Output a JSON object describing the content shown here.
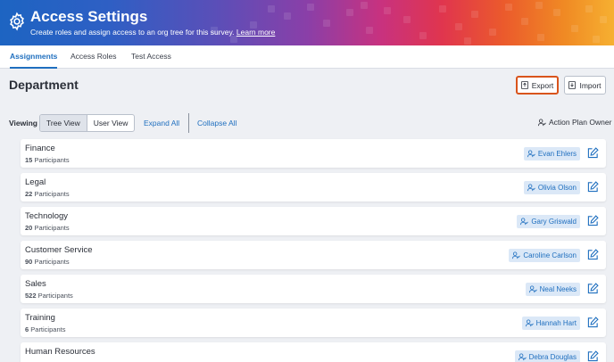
{
  "banner": {
    "title": "Access Settings",
    "subtitle": "Create roles and assign access to an org tree for this survey.",
    "learn_more": "Learn more",
    "icon": "gear-icon"
  },
  "tabs": [
    {
      "label": "Assignments",
      "active": true
    },
    {
      "label": "Access Roles",
      "active": false
    },
    {
      "label": "Test Access",
      "active": false
    }
  ],
  "page_title": "Department",
  "toolbar": {
    "export_label": "Export",
    "import_label": "Import"
  },
  "view": {
    "viewing_label": "Viewing",
    "tree_view": "Tree View",
    "user_view": "User View",
    "expand_all": "Expand All",
    "collapse_all": "Collapse All",
    "action_plan_owner": "Action Plan Owner"
  },
  "departments": [
    {
      "name": "Finance",
      "count": "15",
      "count_label": "Participants",
      "owner": "Evan Ehlers"
    },
    {
      "name": "Legal",
      "count": "22",
      "count_label": "Participants",
      "owner": "Olivia Olson"
    },
    {
      "name": "Technology",
      "count": "20",
      "count_label": "Participants",
      "owner": "Gary Griswald"
    },
    {
      "name": "Customer Service",
      "count": "90",
      "count_label": "Participants",
      "owner": "Caroline Carlson"
    },
    {
      "name": "Sales",
      "count": "522",
      "count_label": "Participants",
      "owner": "Neal Neeks"
    },
    {
      "name": "Training",
      "count": "6",
      "count_label": "Participants",
      "owner": "Hannah Hart"
    },
    {
      "name": "Human Resources",
      "count": "",
      "count_label": "",
      "owner": "Debra Douglas"
    }
  ],
  "colors": {
    "accent": "#1f6fbf",
    "export_highlight": "#d9541c",
    "owner_chip": "#dbe8f7"
  }
}
